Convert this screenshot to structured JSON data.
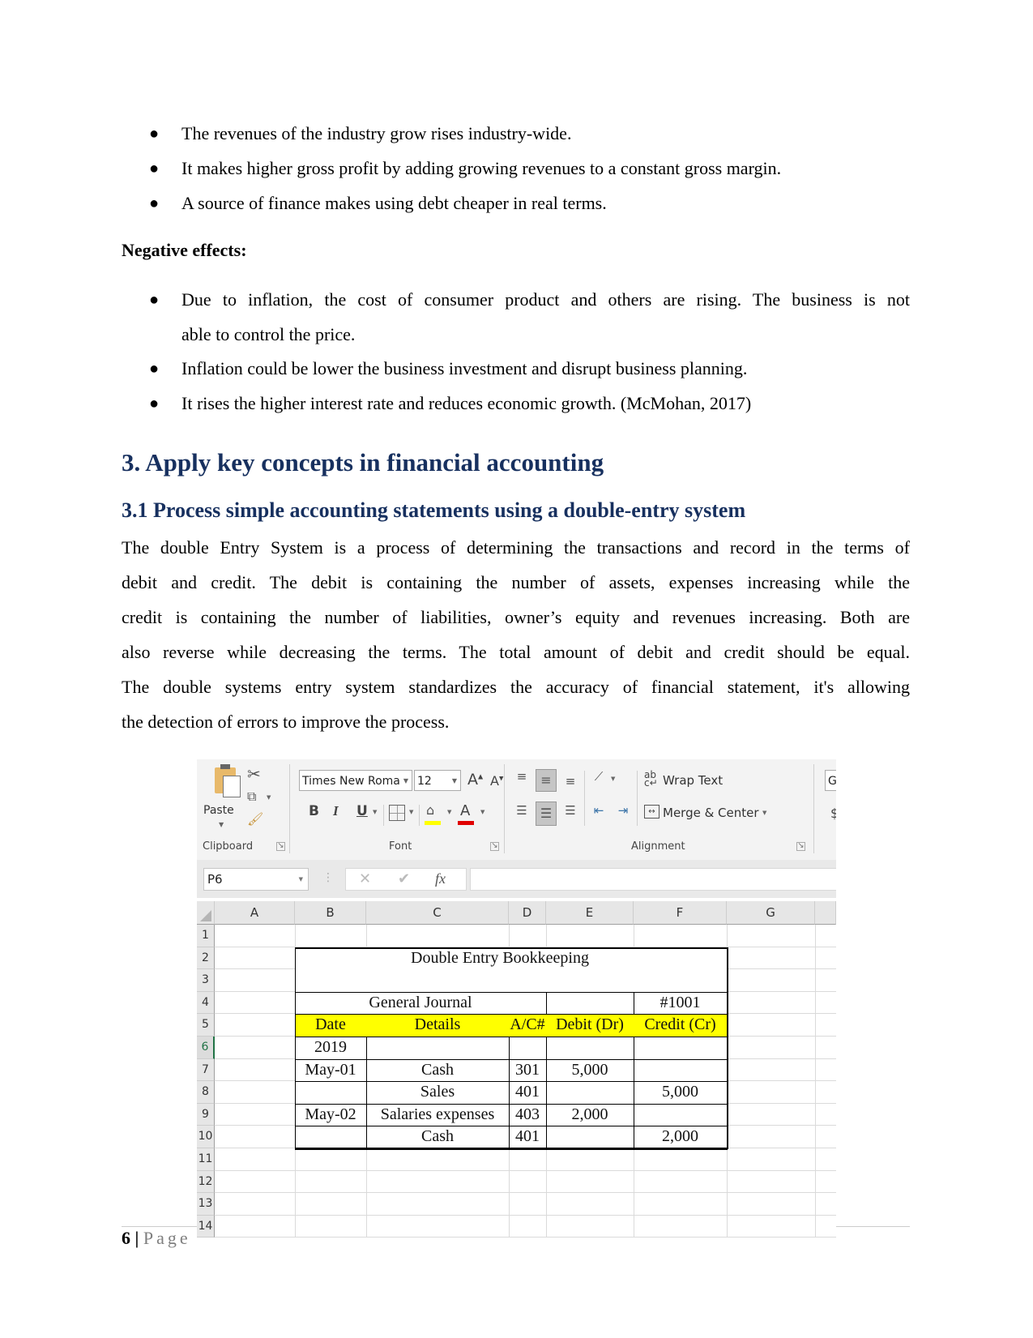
{
  "positive_bullets": [
    "The revenues of the industry grow rises industry-wide.",
    "It makes higher gross profit by adding growing revenues to a constant gross margin.",
    "A source of finance makes using debt cheaper in real terms."
  ],
  "negative_heading": "Negative effects:",
  "negative_bullets": [
    {
      "line1": "Due to inflation, the cost of consumer product and others are rising. The business is not",
      "line2": "able to control the price."
    },
    {
      "line1": "Inflation could be lower the business investment and disrupt business planning."
    },
    {
      "line1": "It rises the higher interest rate and reduces economic growth. (McMohan, 2017)"
    }
  ],
  "section_heading": "3. Apply key concepts in financial accounting",
  "subsection_heading": "3.1 Process simple accounting statements using a double-entry system",
  "paragraph_lines": [
    "The double Entry System is a process of determining the transactions and record in the terms of",
    "debit and credit. The debit is containing the number of assets, expenses increasing while the",
    "credit is containing the number of liabilities, owner’s equity and revenues increasing. Both are",
    "also reverse while decreasing the terms. The total amount of debit and credit should be equal.",
    "The double systems entry system standardizes the accuracy of financial statement, it's allowing",
    "the detection of errors to improve the process."
  ],
  "excel": {
    "ribbon": {
      "clipboard": {
        "paste_label": "Paste",
        "group_label": "Clipboard"
      },
      "font": {
        "font_name": "Times New Roma",
        "font_size": "12",
        "group_label": "Font",
        "bold": "B",
        "italic": "I",
        "underline": "U",
        "grow": "A",
        "shrink": "A",
        "font_color_letter": "A"
      },
      "alignment": {
        "wrap_text": "Wrap Text",
        "merge_center": "Merge & Center",
        "group_label": "Alignment"
      },
      "number_partial": "G",
      "highlight_color": "#ffff00",
      "font_color": "#e00000"
    },
    "formula_bar": {
      "name_box": "P6",
      "fx_label": "fx",
      "formula": ""
    },
    "columns": [
      "A",
      "B",
      "C",
      "D",
      "E",
      "F",
      "G"
    ],
    "rows": [
      "1",
      "2",
      "3",
      "4",
      "5",
      "6",
      "7",
      "8",
      "9",
      "10",
      "11",
      "12",
      "13",
      "14"
    ],
    "selected_row": "6",
    "sheet": {
      "title": "Double Entry Bookkeeping",
      "journal_label": "General Journal",
      "journal_number": "#1001",
      "header_fill": "#ffff00",
      "headers": [
        "Date",
        "Details",
        "A/C#",
        "Debit (Dr)",
        "Credit (Cr)"
      ],
      "year": "2019",
      "entries": [
        {
          "date": "May-01",
          "details": "Cash",
          "account": "301",
          "debit": "5,000",
          "credit": ""
        },
        {
          "date": "",
          "details": "Sales",
          "account": "401",
          "debit": "",
          "credit": "5,000"
        },
        {
          "date": "May-02",
          "details": "Salaries expenses",
          "account": "403",
          "debit": "2,000",
          "credit": ""
        },
        {
          "date": "",
          "details": "Cash",
          "account": "401",
          "debit": "",
          "credit": "2,000"
        }
      ]
    }
  },
  "footer": {
    "page_number": "6",
    "separator": "|",
    "page_label": "Page"
  }
}
